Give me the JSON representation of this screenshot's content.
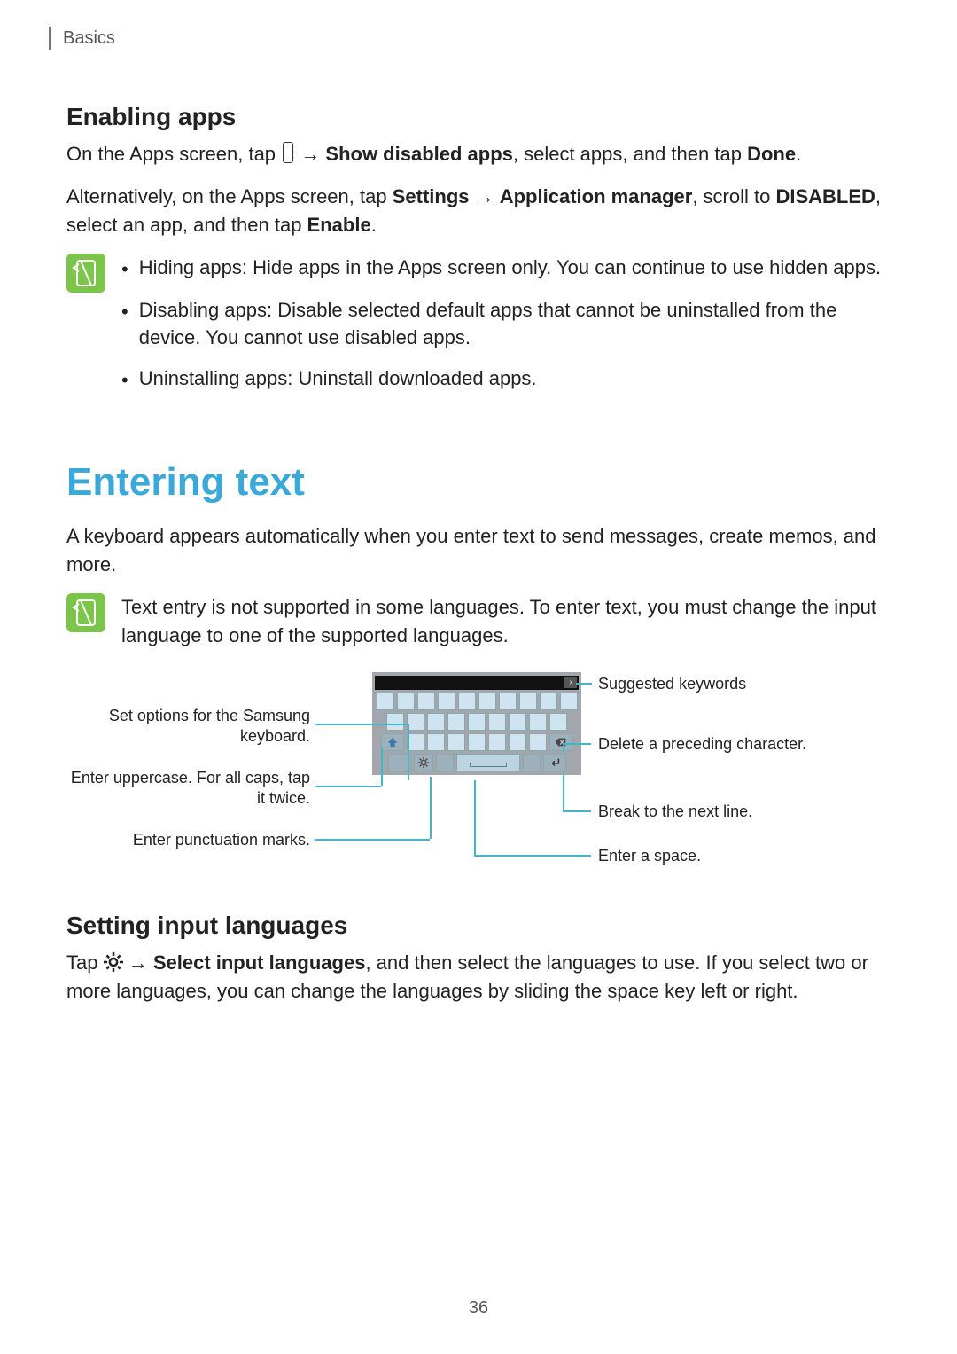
{
  "header": {
    "chapter": "Basics"
  },
  "section1": {
    "heading": "Enabling apps",
    "p1_a": "On the Apps screen, tap ",
    "p1_b": " → ",
    "p1_c": "Show disabled apps",
    "p1_d": ", select apps, and then tap ",
    "p1_e": "Done",
    "p1_f": ".",
    "p2_a": "Alternatively, on the Apps screen, tap ",
    "p2_b": "Settings",
    "p2_c": " → ",
    "p2_d": "Application manager",
    "p2_e": ", scroll to ",
    "p2_f": "DISABLED",
    "p2_g": ", select an app, and then tap ",
    "p2_h": "Enable",
    "p2_i": ".",
    "note": {
      "bullets": [
        "Hiding apps: Hide apps in the Apps screen only. You can continue to use hidden apps.",
        "Disabling apps: Disable selected default apps that cannot be uninstalled from the device. You cannot use disabled apps.",
        "Uninstalling apps: Uninstall downloaded apps."
      ]
    }
  },
  "section2": {
    "heading": "Entering text",
    "p1": "A keyboard appears automatically when you enter text to send messages, create memos, and more.",
    "note": "Text entry is not supported in some languages. To enter text, you must change the input language to one of the supported languages.",
    "callouts": {
      "left1": "Set options for the Samsung keyboard.",
      "left2": "Enter uppercase. For all caps, tap it twice.",
      "left3": "Enter punctuation marks.",
      "right1": "Suggested keywords",
      "right2": "Delete a preceding character.",
      "right3": "Break to the next line.",
      "right4": "Enter a space."
    }
  },
  "section3": {
    "heading": "Setting input languages",
    "p1_a": "Tap ",
    "p1_b": " → ",
    "p1_c": "Select input languages",
    "p1_d": ", and then select the languages to use. If you select two or more languages, you can change the languages by sliding the space key left or right."
  },
  "page_number": "36",
  "icons": {
    "more": "more-icon",
    "note": "note-icon",
    "gear": "gear-icon",
    "shift": "shift-up-icon",
    "backspace": "backspace-icon",
    "enter": "enter-icon",
    "chevron": "chevron-right-icon"
  }
}
